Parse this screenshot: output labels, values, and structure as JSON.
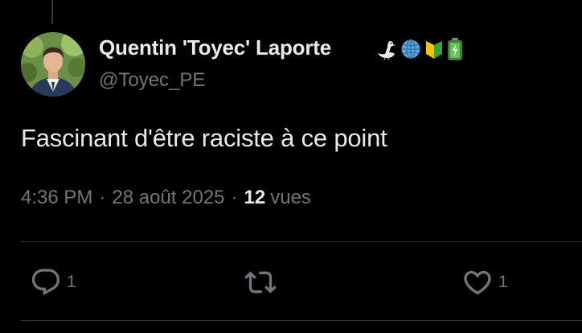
{
  "author": {
    "display_name": "Quentin 'Toyec' Laporte",
    "handle": "@Toyec_PE",
    "badges": [
      "goose-emoji-icon",
      "globe-emoji-icon",
      "beginner-shield-emoji-icon",
      "battery-emoji-icon"
    ]
  },
  "tweet": {
    "text": "Fascinant d'être raciste à ce point",
    "time": "4:36 PM",
    "separator": "·",
    "date": "28 août 2025",
    "views_count": "12",
    "views_label": "vues"
  },
  "actions": {
    "reply_count": "1",
    "retweet_count": "",
    "like_count": "1"
  },
  "colors": {
    "background": "#000000",
    "primary_text": "#e7e9ea",
    "secondary_text": "#71767b",
    "divider": "#2f3336"
  }
}
